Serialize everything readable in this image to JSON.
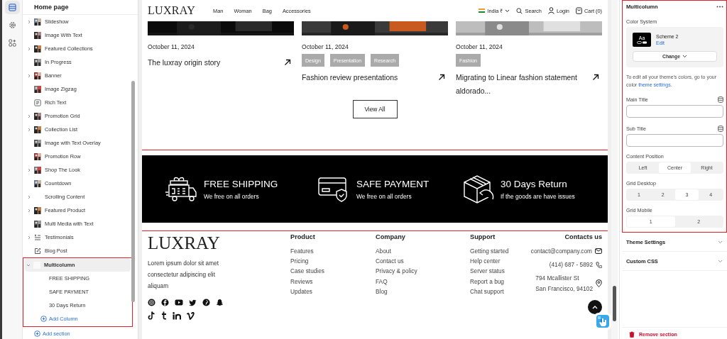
{
  "rail": [
    {
      "selected": true
    },
    {
      "selected": false
    },
    {
      "selected": false
    }
  ],
  "sidebar": {
    "title": "Home page",
    "sections": [
      {
        "label": "Slideshow",
        "kind": "thumbnail",
        "expanded": false,
        "selected": false
      },
      {
        "label": "Image With Text",
        "kind": "thumbnail",
        "selected": false
      },
      {
        "label": "Featured Collections",
        "kind": "thumbnail",
        "expanded": false,
        "selected": false
      },
      {
        "label": "In Progress",
        "kind": "thumbnail",
        "selected": false
      },
      {
        "label": "Banner",
        "kind": "thumbnail",
        "expanded": false,
        "selected": false
      },
      {
        "label": "Image Zigzag",
        "kind": "thumbnail",
        "selected": false
      },
      {
        "label": "Rich Text",
        "kind": "text",
        "selected": false
      },
      {
        "label": "Promotion Grid",
        "kind": "thumbnail",
        "expanded": false,
        "selected": false
      },
      {
        "label": "Collection List",
        "kind": "thumbnail",
        "expanded": false,
        "selected": false
      },
      {
        "label": "Image with Text Overlay",
        "kind": "thumbnail",
        "selected": false
      },
      {
        "label": "Promotion Row",
        "kind": "thumbnail",
        "selected": false
      },
      {
        "label": "Shop The Look",
        "kind": "thumbnail",
        "expanded": false,
        "selected": false
      },
      {
        "label": "Countdown",
        "kind": "thumbnail",
        "selected": false
      },
      {
        "label": "Scrolling Content",
        "kind": "none",
        "expanded": false,
        "selected": false
      },
      {
        "label": "Featured Product",
        "kind": "thumbnail",
        "expanded": false,
        "selected": false
      },
      {
        "label": "Multi Media with Text",
        "kind": "thumbnail",
        "selected": false
      },
      {
        "label": "Testimonials",
        "kind": "list",
        "expanded": false,
        "selected": false
      },
      {
        "label": "Blog Post",
        "kind": "edit",
        "selected": false
      },
      {
        "label": "Multicolumn",
        "kind": "blank",
        "expanded": true,
        "selected": true,
        "children": [
          {
            "label": "FREE SHIPPING"
          },
          {
            "label": "SAFE PAYMENT"
          },
          {
            "label": "30 Days Return"
          }
        ],
        "add_child": "Add Column"
      }
    ],
    "add_section": "Add section"
  },
  "preview": {
    "nav": {
      "logo": "LUXRAY",
      "links": [
        "Man",
        "Woman",
        "Bag",
        "Accessories"
      ],
      "region": "India ₹",
      "search": "Search",
      "login": "Login",
      "cart": "Cart (0)"
    },
    "posts": [
      {
        "date": "October 11, 2024",
        "title": "The luxray origin story"
      },
      {
        "date": "October 11, 2024",
        "tags": [
          "Design",
          "Presentation",
          "Research"
        ],
        "title": "Fashion review presentations"
      },
      {
        "date": "October 11, 2024",
        "tags": [
          "Fashion"
        ],
        "title": "Migrating to Linear fashion statement aldorado..."
      }
    ],
    "view_all": "View All",
    "features": [
      {
        "title": "FREE SHIPPING",
        "text": "We free on all orders"
      },
      {
        "title": "SAFE PAYMENT",
        "text": "We free on all orders"
      },
      {
        "title": "30 Days Return",
        "text": "If the goods are have issues"
      }
    ],
    "footer": {
      "logo": "LUXRAY",
      "description": "Lorem ipsum dolor sit amet consectetur adipiscing elit aliquam",
      "columns": [
        {
          "title": "Product",
          "links": [
            "Features",
            "Pricing",
            "Case studies",
            "Reviews",
            "Updates"
          ]
        },
        {
          "title": "Company",
          "links": [
            "About",
            "Contact us",
            "Privacy & policy",
            "FAQ",
            "Blog"
          ]
        },
        {
          "title": "Support",
          "links": [
            "Getting started",
            "Help center",
            "Server status",
            "Report a bug",
            "Chat support"
          ]
        }
      ],
      "contacts": {
        "title": "Contacts us",
        "items": [
          {
            "kind": "email",
            "lines": [
              "contact@company.com"
            ]
          },
          {
            "kind": "phone",
            "lines": [
              "(414) 687 - 5892"
            ]
          },
          {
            "kind": "address",
            "lines": [
              "794 Mcallister St",
              "San Francisco, 94102"
            ]
          }
        ]
      }
    }
  },
  "panel": {
    "title": "Multicolumn",
    "color_label": "Color System",
    "scheme": {
      "swatch": "Aa",
      "name": "Scheme 2",
      "edit": "Edit",
      "change": "Change"
    },
    "hint": {
      "text": "To edit all your theme's colors, go to your color",
      "link": "theme settings",
      "end": "."
    },
    "fields": [
      {
        "label": "Main Title"
      },
      {
        "label": "Sub Title"
      }
    ],
    "segments": [
      {
        "label": "Content Position",
        "options": [
          {
            "label": "Left",
            "selected": false
          },
          {
            "label": "Center",
            "selected": true
          },
          {
            "label": "Right",
            "selected": false
          }
        ]
      },
      {
        "label": "Grid Desktop",
        "options": [
          {
            "label": "1",
            "selected": false
          },
          {
            "label": "2",
            "selected": false
          },
          {
            "label": "3",
            "selected": true
          },
          {
            "label": "4",
            "selected": false
          }
        ]
      },
      {
        "label": "Grid Mobile",
        "options": [
          {
            "label": "1",
            "selected": true
          },
          {
            "label": "2",
            "selected": false
          }
        ]
      }
    ],
    "collapsibles": [
      {
        "label": "Theme Settings",
        "expanded": false
      },
      {
        "label": "Custom CSS",
        "expanded": false
      }
    ],
    "remove": "Remove section"
  }
}
